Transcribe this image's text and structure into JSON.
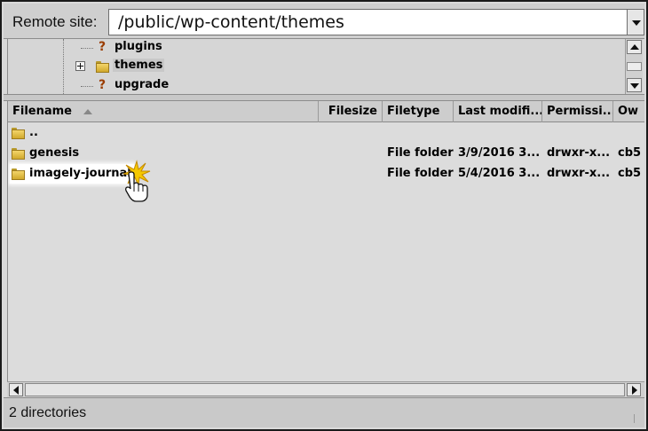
{
  "remote_site": {
    "label": "Remote site:",
    "path": "/public/wp-content/themes"
  },
  "tree": {
    "items": [
      {
        "label": "plugins",
        "icon": "unknown-folder-icon",
        "expandable": false,
        "selected": false
      },
      {
        "label": "themes",
        "icon": "folder-icon",
        "expandable": true,
        "selected": true
      },
      {
        "label": "upgrade",
        "icon": "unknown-folder-icon",
        "expandable": false,
        "selected": false
      }
    ]
  },
  "file_list": {
    "columns": [
      "Filename",
      "Filesize",
      "Filetype",
      "Last modifi...",
      "Permissi...",
      "Ow"
    ],
    "sort_column": "Filename",
    "rows": [
      {
        "name": "..",
        "filesize": "",
        "filetype": "",
        "modified": "",
        "permissions": "",
        "owner": ""
      },
      {
        "name": "genesis",
        "filesize": "",
        "filetype": "File folder",
        "modified": "3/9/2016 3...",
        "permissions": "drwxr-x...",
        "owner": "cb5"
      },
      {
        "name": "imagely-journal",
        "filesize": "",
        "filetype": "File folder",
        "modified": "5/4/2016 3...",
        "permissions": "drwxr-x...",
        "owner": "cb5"
      }
    ]
  },
  "status": {
    "text": "2 directories"
  },
  "colors": {
    "folder": "#e8c24a",
    "unknown_folder": "#9a3c00",
    "panel_bg": "#dcdcdc",
    "highlight_bg": "#ffffff"
  }
}
